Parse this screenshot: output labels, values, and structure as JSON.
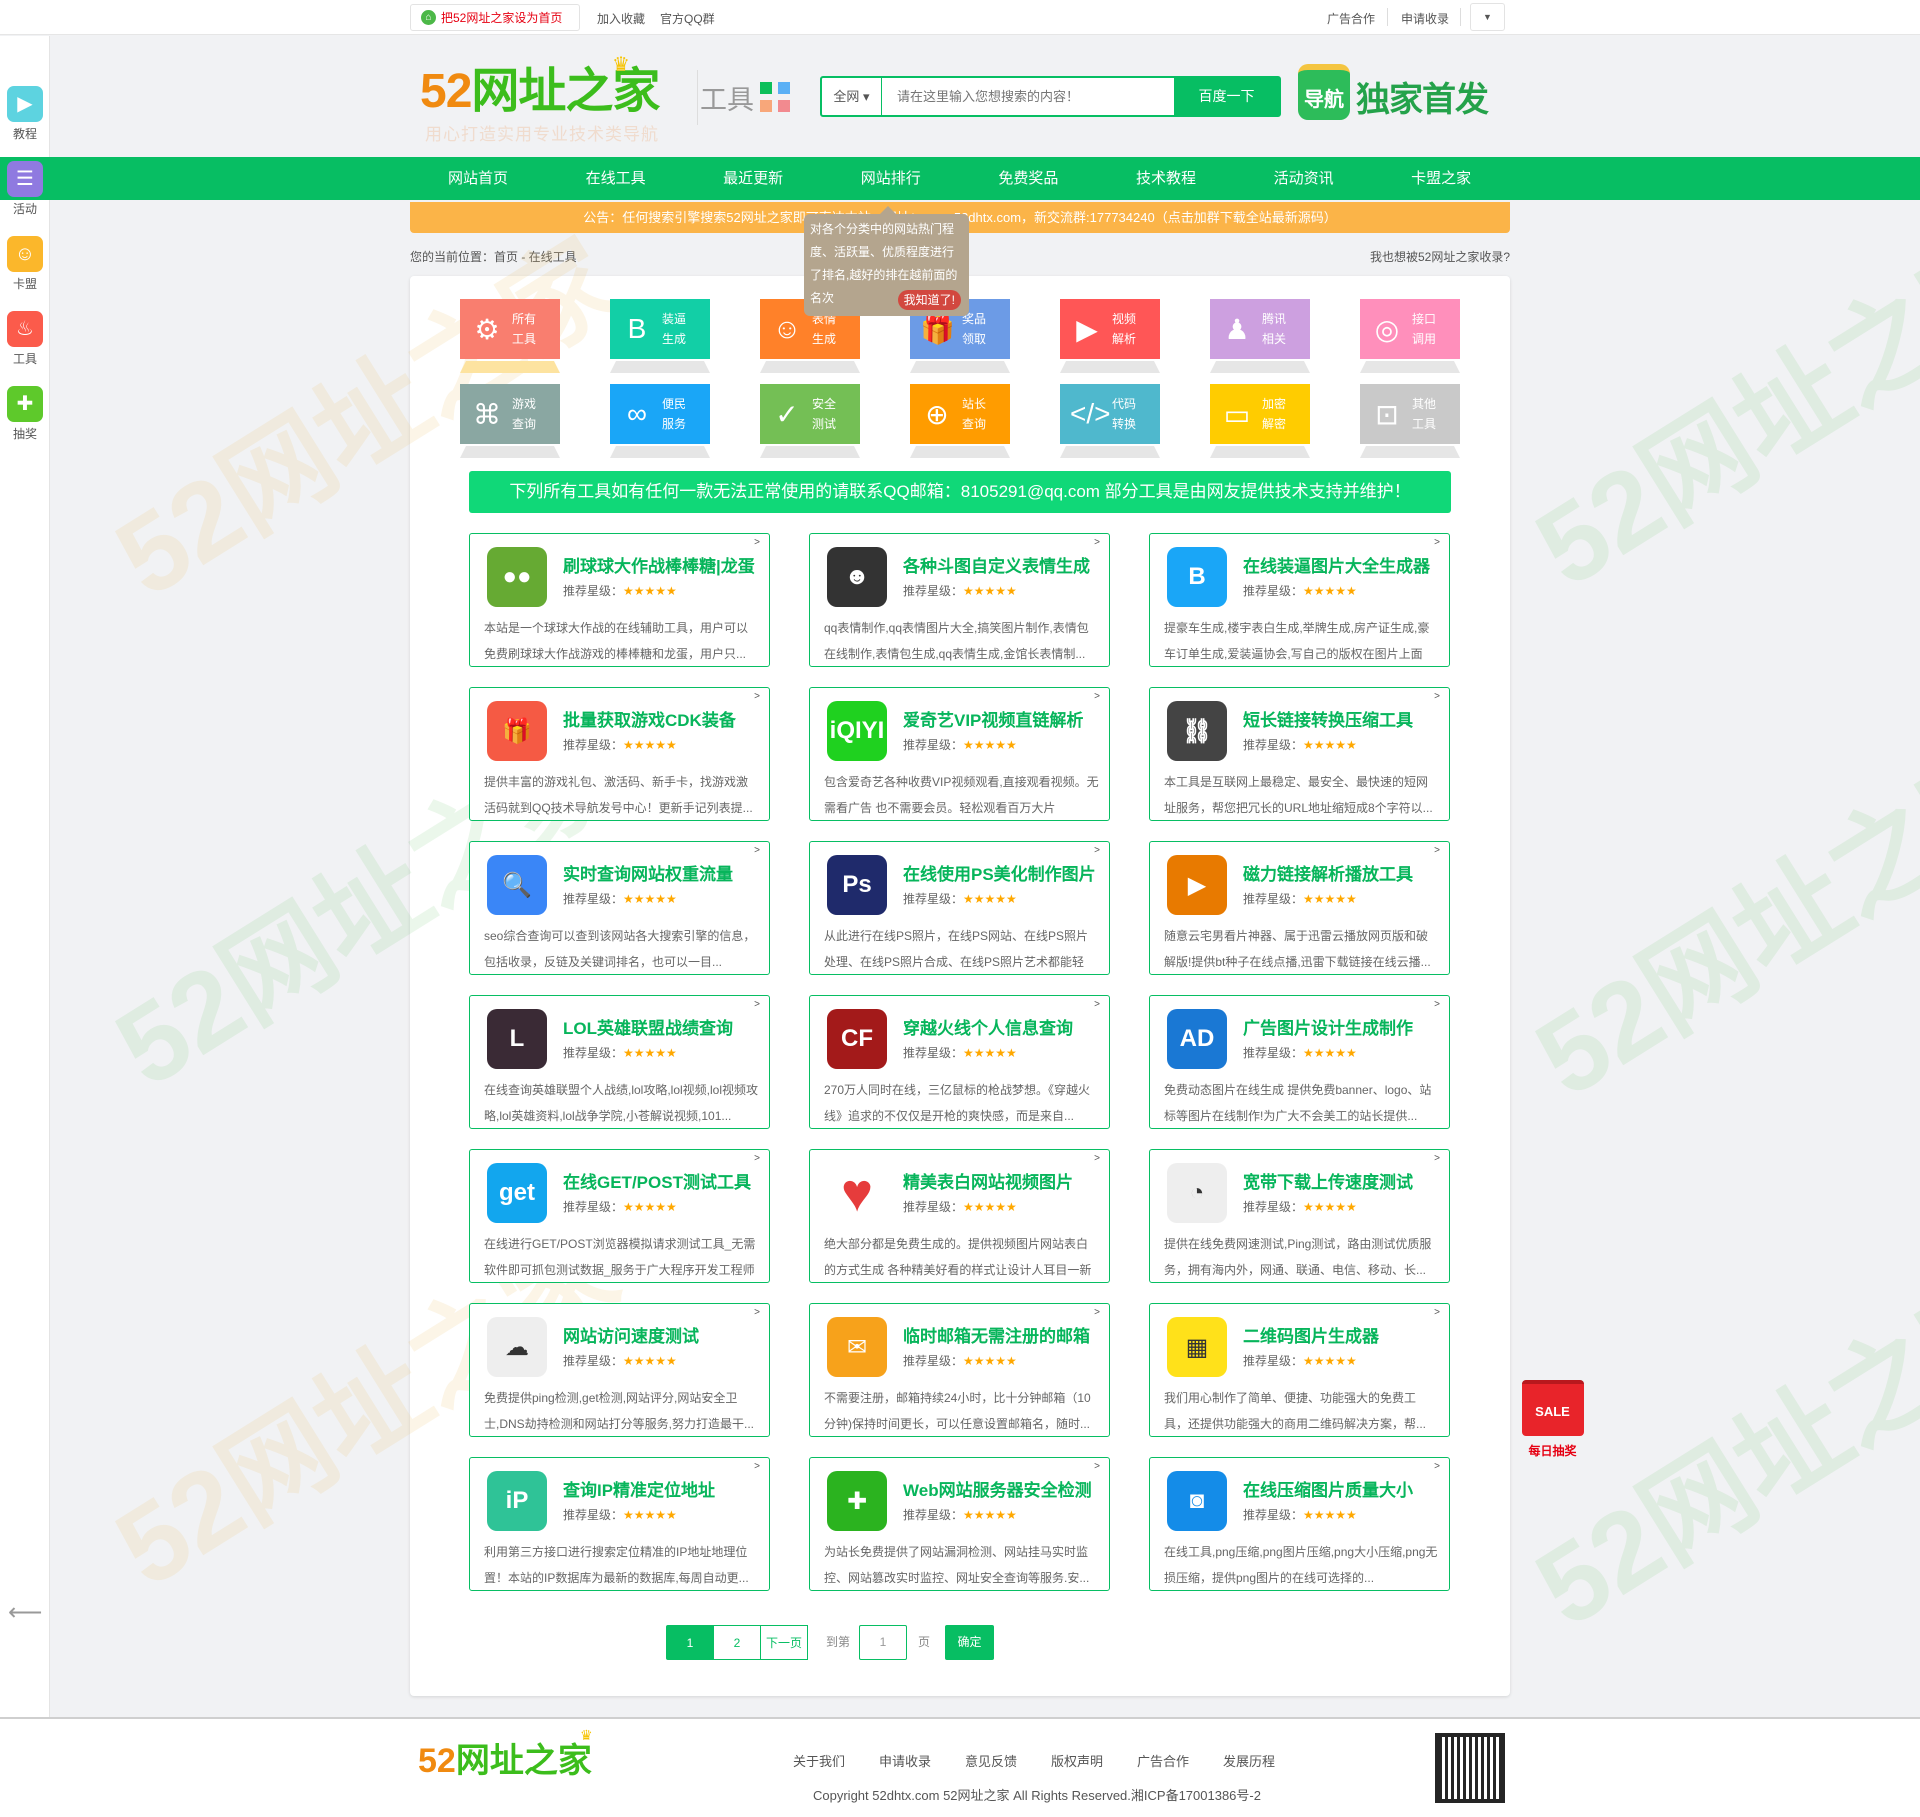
{
  "topbar": {
    "set_home": "把52网址之家设为首页",
    "favorite": "加入收藏",
    "qq_group": "官方QQ群",
    "ad": "广告合作",
    "apply": "申请收录",
    "dropdown": "▼"
  },
  "sidebar": {
    "items": [
      {
        "label": "教程",
        "icon": "tv-icon",
        "glyph": "▶",
        "color": "#5dd3e0"
      },
      {
        "label": "活动",
        "icon": "news-icon",
        "glyph": "☰",
        "color": "#8f7ae0"
      },
      {
        "label": "卡盟",
        "icon": "smile-icon",
        "glyph": "☺",
        "color": "#fbb72b"
      },
      {
        "label": "工具",
        "icon": "flame-icon",
        "glyph": "♨",
        "color": "#fb5b4b"
      },
      {
        "label": "抽奖",
        "icon": "gamepad-icon",
        "glyph": "✚",
        "color": "#5ec92b"
      }
    ],
    "back": "⟵"
  },
  "watermark": "52网址之家",
  "header": {
    "logo_num": "52",
    "logo_text": "网址之家",
    "slogan": "用心打造实用专业技术类导航",
    "section": "工具",
    "badge_icon": "导航",
    "badge_text": "独家首发",
    "square_colors": [
      "#0cbf5a",
      "#5ab0f5",
      "#f8a77a",
      "#f28a8f"
    ]
  },
  "search": {
    "scope": "全网 ▾",
    "placeholder": "请在这里输入您想搜索的内容！",
    "button": "百度一下"
  },
  "nav": [
    "网站首页",
    "在线工具",
    "最近更新",
    "网站排行",
    "免费奖品",
    "技术教程",
    "活动资讯",
    "卡盟之家"
  ],
  "notice": "公告：任何搜索引擎搜索52网址之家即可直达本站，网址：www.52dhtx.com，新交流群:177734240（点击加群下载全站最新源码）",
  "breadcrumb": "您的当前位置：首页 - 在线工具",
  "breadcrumb_right": "我也想被52网址之家收录?",
  "tooltip": {
    "text": "对各个分类中的网站热门程度、活跃量、优质程度进行了排名,越好的排在越前面的名次",
    "button": "我知道了!"
  },
  "categories": [
    {
      "l1": "所有",
      "l2": "工具",
      "icon": "gear-icon",
      "glyph": "⚙",
      "color": "#f97e6f",
      "shadow": "#fde3a0"
    },
    {
      "l1": "装逼",
      "l2": "生成",
      "icon": "b-icon",
      "glyph": "B",
      "color": "#12cfa6"
    },
    {
      "l1": "表情",
      "l2": "生成",
      "icon": "smile-icon",
      "glyph": "☺",
      "color": "#ff8129"
    },
    {
      "l1": "奖品",
      "l2": "领取",
      "icon": "gift-icon",
      "glyph": "🎁",
      "color": "#6c9be6"
    },
    {
      "l1": "视频",
      "l2": "解析",
      "icon": "video-icon",
      "glyph": "▶",
      "color": "#ff5656"
    },
    {
      "l1": "腾讯",
      "l2": "相关",
      "icon": "qq-icon",
      "glyph": "♟",
      "color": "#cda0e0"
    },
    {
      "l1": "接口",
      "l2": "调用",
      "icon": "api-icon",
      "glyph": "◎",
      "color": "#ff8fbb"
    },
    {
      "l1": "游戏",
      "l2": "查询",
      "icon": "gamepad-icon",
      "glyph": "⌘",
      "color": "#8aa7a2"
    },
    {
      "l1": "便民",
      "l2": "服务",
      "icon": "grid-icon",
      "glyph": "∞",
      "color": "#1aa6f7"
    },
    {
      "l1": "安全",
      "l2": "测试",
      "icon": "shield-icon",
      "glyph": "✓",
      "color": "#74bf55"
    },
    {
      "l1": "站长",
      "l2": "查询",
      "icon": "globe-icon",
      "glyph": "⊕",
      "color": "#ff9c00"
    },
    {
      "l1": "代码",
      "l2": "转换",
      "icon": "code-icon",
      "glyph": "</>",
      "color": "#4fb8cd"
    },
    {
      "l1": "加密",
      "l2": "解密",
      "icon": "monitor-icon",
      "glyph": "▭",
      "color": "#ffcc00"
    },
    {
      "l1": "其他",
      "l2": "工具",
      "icon": "toolbox-icon",
      "glyph": "⊡",
      "color": "#c9c9c9"
    }
  ],
  "banner": "下列所有工具如有任何一款无法正常使用的请联系QQ邮箱：8105291@qq.com 部分工具是由网友提供技术支持并维护！",
  "rating_label": "推荐星级：",
  "stars": "★★★★★",
  "arrow": ">",
  "tools": [
    {
      "title": "刷球球大作战棒棒糖|龙蛋",
      "icon": "ball-game-icon",
      "glyph": "●●",
      "color": "#6a3",
      "desc": "本站是一个球球大作战的在线辅助工具，用户可以免费刷球球大作战游戏的棒棒糖和龙蛋，用户只..."
    },
    {
      "title": "各种斗图自定义表情生成",
      "icon": "panda-meme-icon",
      "glyph": "☻",
      "color": "#333",
      "desc": "qq表情制作,qq表情图片大全,搞笑图片制作,表情包在线制作,表情包生成,qq表情生成,金馆长表情制..."
    },
    {
      "title": "在线装逼图片大全生成器",
      "icon": "b-logo-icon",
      "glyph": "B",
      "color": "#1aa6f7",
      "desc": "提豪车生成,楼宇表白生成,举牌生成,房产证生成,豪车订单生成,爱装逼协会,写自己的版权在图片上面"
    },
    {
      "title": "批量获取游戏CDK装备",
      "icon": "gift-icon",
      "glyph": "🎁",
      "color": "#f55a44",
      "desc": "提供丰富的游戏礼包、激活码、新手卡，找游戏激活码就到QQ技术导航发号中心！更新手记列表提..."
    },
    {
      "title": "爱奇艺VIP视频直链解析",
      "icon": "iqiyi-icon",
      "glyph": "iQIYI",
      "color": "#1fd11f",
      "desc": "包含爱奇艺各种收费VIP视频观看,直接观看视频。无需看广告 也不需要会员。轻松观看百万大片"
    },
    {
      "title": "短长链接转换压缩工具",
      "icon": "link-icon",
      "glyph": "⛓",
      "color": "#444",
      "desc": "本工具是互联网上最稳定、最安全、最快速的短网址服务，帮您把冗长的URL地址缩短成8个字符以..."
    },
    {
      "title": "实时查询网站权重流量",
      "icon": "search-plus-icon",
      "glyph": "🔍",
      "color": "#3a86f7",
      "desc": "seo综合查询可以查到该网站各大搜索引擎的信息，包括收录，反链及关键词排名，也可以一目..."
    },
    {
      "title": "在线使用PS美化制作图片",
      "icon": "photoshop-icon",
      "glyph": "Ps",
      "color": "#1f2a6b",
      "desc": "从此进行在线PS照片，在线PS网站、在线PS照片处理、在线PS照片合成、在线PS照片艺术都能轻而..."
    },
    {
      "title": "磁力链接解析播放工具",
      "icon": "player-icon",
      "glyph": "▶",
      "color": "#e87a00",
      "desc": "随意云宅男看片神器、属于迅雷云播放网页版和破解版!提供bt种子在线点播,迅雷下载链接在线云播..."
    },
    {
      "title": "LOL英雄联盟战绩查询",
      "icon": "lol-icon",
      "glyph": "L",
      "color": "#3a2a35",
      "desc": "在线查询英雄联盟个人战绩,lol攻略,lol视频,lol视频攻略,lol英雄资料,lol战争学院,小苍解说视频,101..."
    },
    {
      "title": "穿越火线个人信息查询",
      "icon": "cf-icon",
      "glyph": "CF",
      "color": "#a31a1a",
      "desc": "270万人同时在线，三亿鼠标的枪战梦想。《穿越火线》追求的不仅仅是开枪的爽快感，而是来自..."
    },
    {
      "title": "广告图片设计生成制作",
      "icon": "ad-icon",
      "glyph": "AD",
      "color": "#1a78d4",
      "desc": "免费动态图片在线生成 提供免费banner、logo、站标等图片在线制作!为广大不会美工的站长提供..."
    },
    {
      "title": "在线GET/POST测试工具",
      "icon": "get-icon",
      "glyph": "get",
      "color": "#12a6ee",
      "desc": "在线进行GET/POST浏览器模拟请求测试工具_无需软件即可抓包测试数据_服务于广大程序开发工程师"
    },
    {
      "title": "精美表白网站视频图片",
      "icon": "heart-icon",
      "glyph": "♥",
      "color": "#fff",
      "desc": "绝大部分都是免费生成的。提供视频图片网站表白的方式生成 各种精美好看的样式让设计人耳目一新"
    },
    {
      "title": "宽带下载上传速度测试",
      "icon": "speedometer-icon",
      "glyph": "◔",
      "color": "#eee",
      "desc": "提供在线免费网速测试,Ping测试，路由测试优质服务，拥有海内外，网通、联通、电信、移动、长..."
    },
    {
      "title": "网站访问速度测试",
      "icon": "cloud-icon",
      "glyph": "☁",
      "color": "#eee",
      "desc": "免费提供ping检测,get检测,网站评分,网站安全卫士,DNS劫持检测和网站打分等服务,努力打造最干..."
    },
    {
      "title": "临时邮箱无需注册的邮箱",
      "icon": "mail-icon",
      "glyph": "✉",
      "color": "#f7a21b",
      "desc": "不需要注册，邮箱持续24小时，比十分钟邮箱（10分钟)保持时间更长，可以任意设置邮箱名，随时..."
    },
    {
      "title": "二维码图片生成器",
      "icon": "qrcode-icon",
      "glyph": "▦",
      "color": "#ffe11a",
      "desc": "我们用心制作了简单、便捷、功能强大的免费工具，还提供功能强大的商用二维码解决方案，帮..."
    },
    {
      "title": "查询IP精准定位地址",
      "icon": "ip-icon",
      "glyph": "iP",
      "color": "#2fc397",
      "desc": "利用第三方接口进行搜索定位精准的IP地址地理位置！本站的IP数据库为最新的数据库,每周自动更..."
    },
    {
      "title": "Web网站服务器安全检测",
      "icon": "shield-plus-icon",
      "glyph": "✚",
      "color": "#2bb31f",
      "desc": "为站长免费提供了网站漏洞检测、网站挂马实时监控、网站篡改实时监控、网址安全查询等服务.安..."
    },
    {
      "title": "在线压缩图片质量大小",
      "icon": "image-compress-icon",
      "glyph": "◙",
      "color": "#148ce8",
      "desc": "在线工具,png压缩,png图片压缩,png大小压缩,png无损压缩，提供png图片的在线可选择的..."
    }
  ],
  "pagination": {
    "pages": [
      "1",
      "2"
    ],
    "current": "1",
    "next": "下一页",
    "goto": "到第",
    "input": "1",
    "page_unit": "页",
    "confirm": "确定"
  },
  "footer": {
    "logo_num": "52",
    "logo_text": "网址之家",
    "links": [
      "关于我们",
      "申请收录",
      "意见反馈",
      "版权声明",
      "广告合作",
      "发展历程"
    ],
    "copyright": "Copyright 52dhtx.com 52网址之家 All Rights Reserved.湘ICP备17001386号-2"
  },
  "lottery": {
    "bag_text": "SALE",
    "label": "每日抽奖"
  }
}
